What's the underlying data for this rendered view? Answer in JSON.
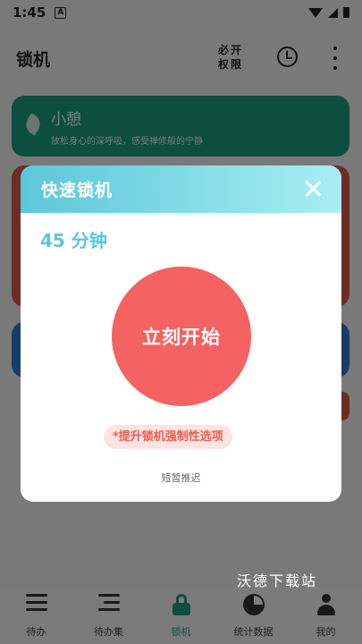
{
  "status_bar": {
    "time": "1:45",
    "badge": "A"
  },
  "app_bar": {
    "title": "锁机",
    "permission_label": "必开权限"
  },
  "cards": [
    {
      "name": "小憩",
      "description": "放松身心的深呼吸，感受禅修般的宁静",
      "color": "#1a9c82"
    }
  ],
  "dialog": {
    "title": "快速锁机",
    "duration": "45 分钟",
    "start_button": "立刻开始",
    "upgrade_option": "*提升锁机强制性选项",
    "postpone": "短暂推迟"
  },
  "bottom_nav": [
    {
      "label": "待办",
      "icon": "list-icon"
    },
    {
      "label": "待办集",
      "icon": "list-set-icon"
    },
    {
      "label": "锁机",
      "icon": "lock-icon",
      "active": true
    },
    {
      "label": "统计数据",
      "icon": "pie-chart-icon"
    },
    {
      "label": "我的",
      "icon": "user-icon"
    }
  ],
  "watermark": "沃德下载站",
  "colors": {
    "accent": "#5cc6d9",
    "start": "#f46262",
    "green": "#1a9c82"
  }
}
